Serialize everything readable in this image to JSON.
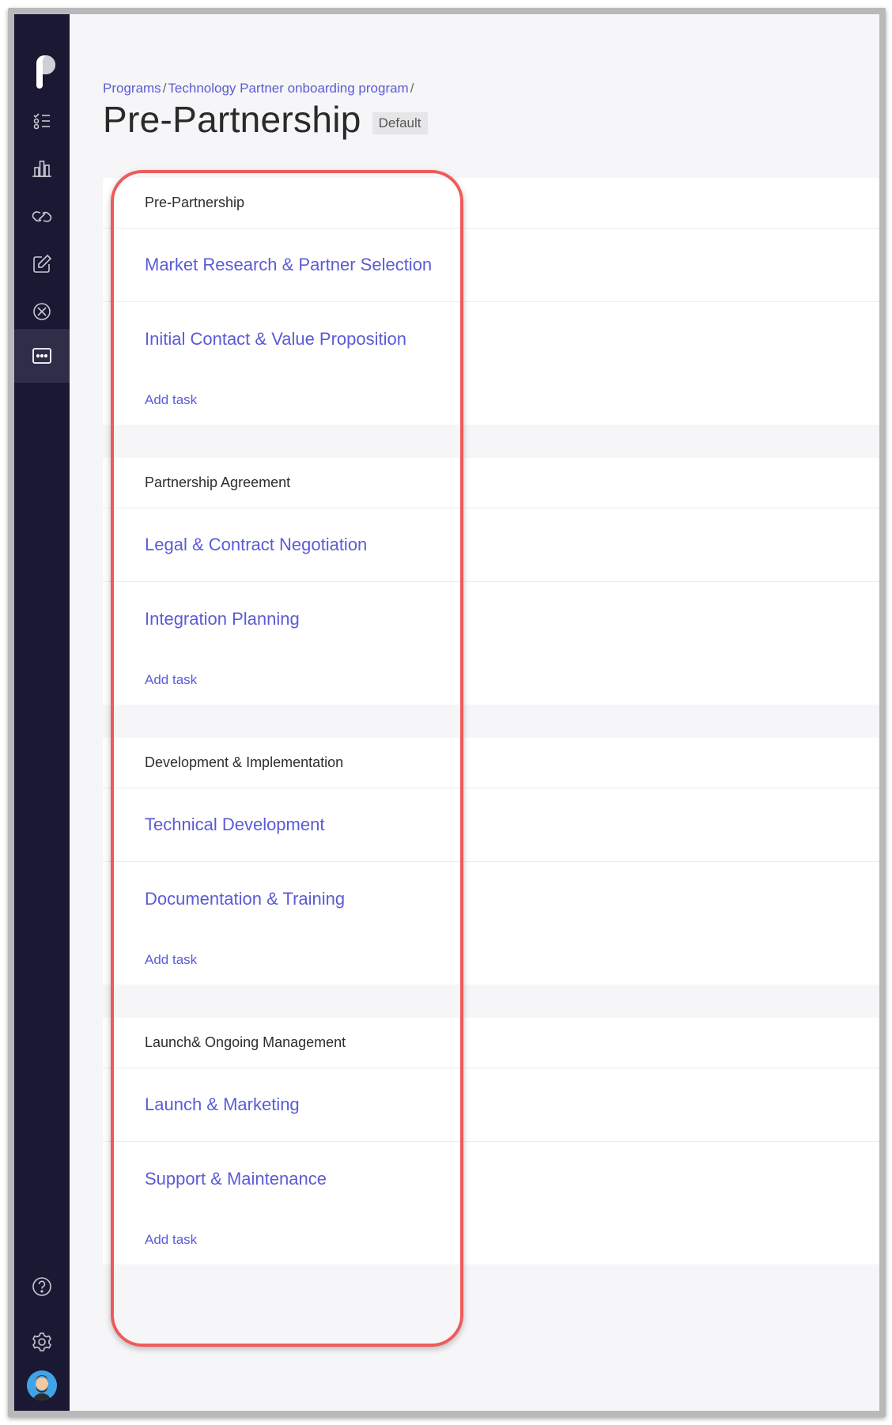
{
  "breadcrumb": {
    "items": [
      "Programs",
      "Technology Partner onboarding program"
    ],
    "separator": "/"
  },
  "page": {
    "title": "Pre-Partnership",
    "badge": "Default"
  },
  "sections": [
    {
      "name": "Pre-Partnership",
      "tasks": [
        "Market Research & Partner Selection",
        "Initial Contact & Value Proposition"
      ],
      "add_task": "Add task"
    },
    {
      "name": "Partnership Agreement",
      "tasks": [
        "Legal & Contract Negotiation",
        "Integration Planning"
      ],
      "add_task": "Add task"
    },
    {
      "name": "Development & Implementation",
      "tasks": [
        "Technical Development",
        "Documentation & Training"
      ],
      "add_task": "Add task"
    },
    {
      "name": "Launch& Ongoing Management",
      "tasks": [
        "Launch & Marketing",
        "Support & Maintenance"
      ],
      "add_task": "Add task"
    }
  ],
  "sidebar": {
    "icons": [
      "tasks-icon",
      "chart-icon",
      "link-icon",
      "edit-icon",
      "compass-icon",
      "dots-window-icon",
      "help-icon",
      "gear-icon"
    ],
    "active": "dots-window-icon"
  },
  "colors": {
    "accent": "#5b5bd6",
    "sidebar": "#1b1834",
    "highlight": "#ef5a5a"
  }
}
